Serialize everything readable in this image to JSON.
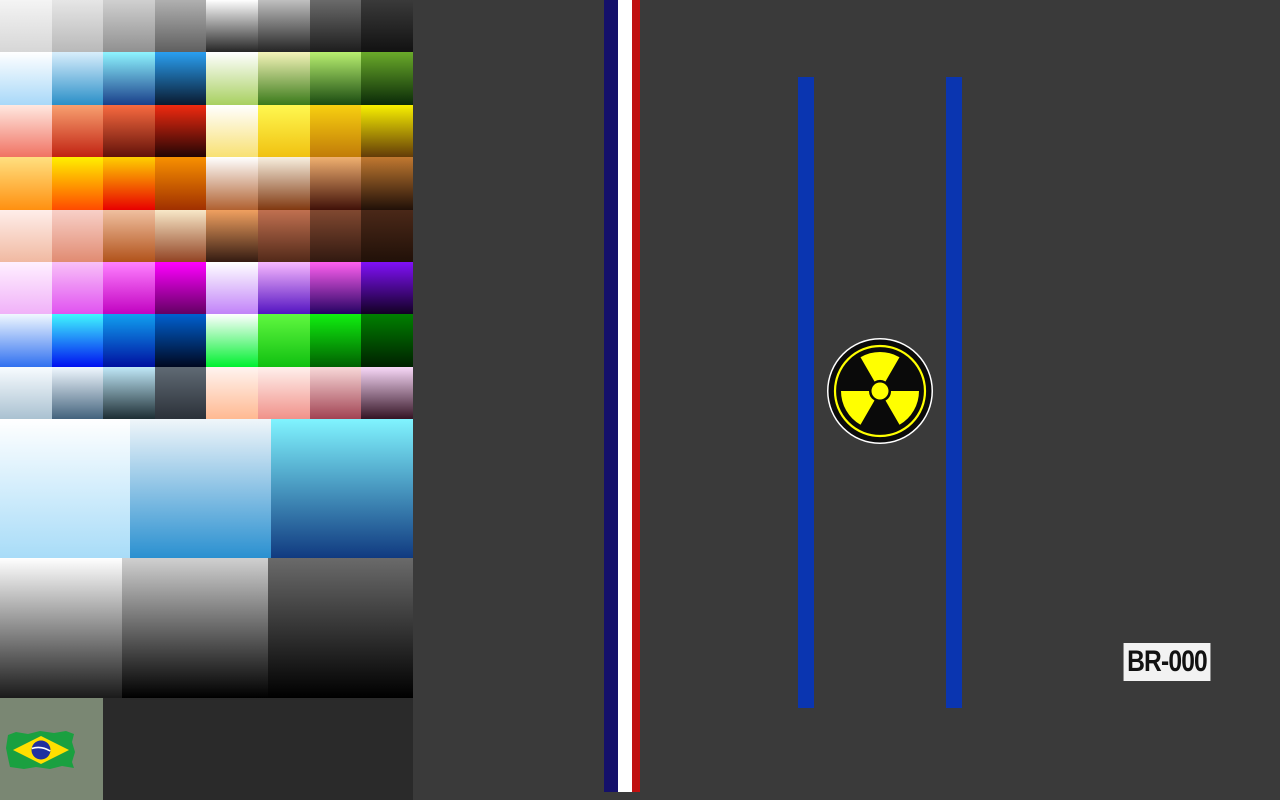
{
  "palette": {
    "rows": [
      [
        [
          "#f4f4f4",
          "#d6d6d6"
        ],
        [
          "#e6e6e6",
          "#b8b8b8"
        ],
        [
          "#d0d0d0",
          "#8f8f8f"
        ],
        [
          "#b0b0b0",
          "#5e5e5e"
        ],
        [
          "#ffffff",
          "#222222"
        ],
        [
          "#bfbfbf",
          "#222222"
        ],
        [
          "#6a6a6a",
          "#1c1c1c"
        ],
        [
          "#3a3a3a",
          "#111111"
        ]
      ],
      [
        [
          "#ffffff",
          "#a8d8f8"
        ],
        [
          "#d8eefc",
          "#2a8fc8"
        ],
        [
          "#8ef4ff",
          "#1a3f8a"
        ],
        [
          "#2a9ff0",
          "#0a1a30"
        ],
        [
          "#ffffff",
          "#a8d060"
        ],
        [
          "#f4f4b8",
          "#3a7a1a"
        ],
        [
          "#b8f070",
          "#1a4a10"
        ],
        [
          "#6aaa2a",
          "#0a2a08"
        ]
      ],
      [
        [
          "#ffe8e0",
          "#f07060"
        ],
        [
          "#f8a070",
          "#c02010"
        ],
        [
          "#f86a40",
          "#601008"
        ],
        [
          "#f02a10",
          "#200404"
        ],
        [
          "#ffffff",
          "#f8e070"
        ],
        [
          "#fff850",
          "#f0c010"
        ],
        [
          "#f8d010",
          "#c07a08"
        ],
        [
          "#f8f000",
          "#603808"
        ]
      ],
      [
        [
          "#ffe080",
          "#ff9010"
        ],
        [
          "#fff000",
          "#ff4a00"
        ],
        [
          "#ffd000",
          "#e80000"
        ],
        [
          "#f89000",
          "#a03000"
        ],
        [
          "#ffffff",
          "#b06030"
        ],
        [
          "#f8f0e0",
          "#803810"
        ],
        [
          "#f0b070",
          "#401008"
        ],
        [
          "#c07830",
          "#201008"
        ]
      ],
      [
        [
          "#ffeeea",
          "#f0b8a0"
        ],
        [
          "#f8d0c8",
          "#e08a70"
        ],
        [
          "#f0c0a0",
          "#b05018"
        ],
        [
          "#f8e8c8",
          "#904020"
        ],
        [
          "#f0a060",
          "#301810"
        ],
        [
          "#c07050",
          "#502818"
        ],
        [
          "#804830",
          "#301810"
        ],
        [
          "#4a2818",
          "#201008"
        ]
      ],
      [
        [
          "#fff0ff",
          "#f0b0f8"
        ],
        [
          "#f8c0f8",
          "#e050f0"
        ],
        [
          "#ff80ff",
          "#c000c0"
        ],
        [
          "#ff00ff",
          "#600060"
        ],
        [
          "#ffffff",
          "#c080f8"
        ],
        [
          "#f8b8ff",
          "#5010c0"
        ],
        [
          "#ff60f0",
          "#200060"
        ],
        [
          "#8010f8",
          "#100020"
        ]
      ],
      [
        [
          "#f0f8ff",
          "#3070f0"
        ],
        [
          "#40f8ff",
          "#0010f0"
        ],
        [
          "#10a0f0",
          "#0010a0"
        ],
        [
          "#0060d0",
          "#000820"
        ],
        [
          "#ffffff",
          "#00f030"
        ],
        [
          "#60f840",
          "#10c010"
        ],
        [
          "#10f010",
          "#006000"
        ],
        [
          "#008000",
          "#002000"
        ]
      ],
      [
        [
          "#f8fcff",
          "#a8c0d0"
        ],
        [
          "#f0f8ff",
          "#40607a"
        ],
        [
          "#c0e8f8",
          "#1a2a30"
        ],
        [
          "#606a74",
          "#2a3038"
        ],
        [
          "#fff4f0",
          "#ffb890"
        ],
        [
          "#fff0ec",
          "#f09088"
        ],
        [
          "#f8d8d8",
          "#a04050"
        ],
        [
          "#f8d8f8",
          "#301020"
        ]
      ]
    ],
    "blue_panels": [
      [
        "#ffffff",
        "#a8dcf8"
      ],
      [
        "#f0f6fa",
        "#2a90d0"
      ],
      [
        "#80f4ff",
        "#103a80"
      ]
    ],
    "gray_panels": [
      [
        "#ffffff",
        "#1a1a1a"
      ],
      [
        "#d0d0d0",
        "#000000"
      ],
      [
        "#6a6a6a",
        "#000000"
      ]
    ]
  },
  "stripe_colors": [
    "#14106a",
    "#ffffff",
    "#c01010"
  ],
  "rail_color": "#0a35b0",
  "radiation": {
    "fill": "#ffff00",
    "ink": "#0a0a0a",
    "rim": "#ffffff"
  },
  "id_tag": {
    "label": "BR-000"
  },
  "flag": {
    "green": "#1aa040",
    "yellow": "#ffdf00",
    "blue": "#2030a0"
  }
}
